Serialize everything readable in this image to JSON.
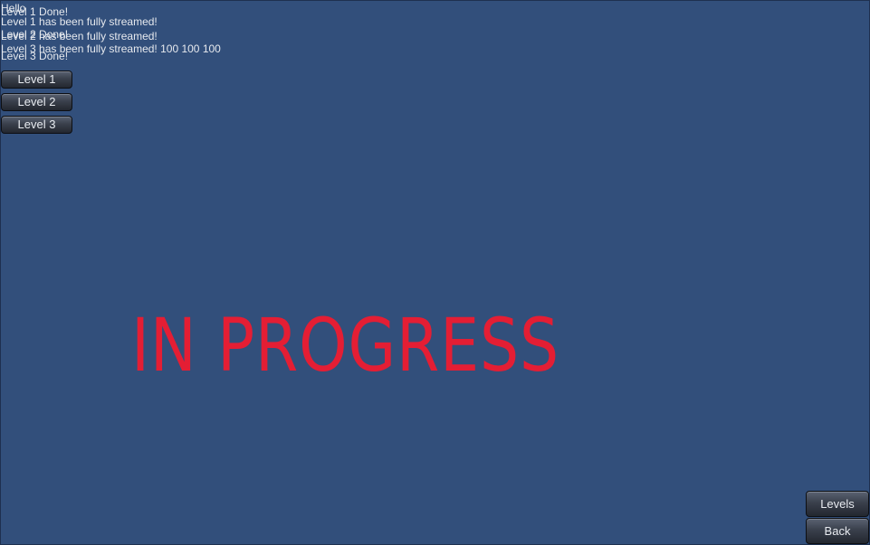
{
  "log": [
    "Hello",
    "Level 1 Done!",
    "Level 1 has been fully streamed!",
    "Level 2 Done!",
    "Level 2 has been fully streamed!",
    "Level 3 has been fully streamed! 100 100 100",
    "Level 3 Done!"
  ],
  "level_buttons": [
    "Level 1",
    "Level 2",
    "Level 3"
  ],
  "banner": "IN PROGRESS",
  "nav": {
    "levels_label": "Levels",
    "back_label": "Back"
  },
  "colors": {
    "background": "#324f7b",
    "banner": "#e41e34",
    "log_text": "#e6e9ee"
  }
}
